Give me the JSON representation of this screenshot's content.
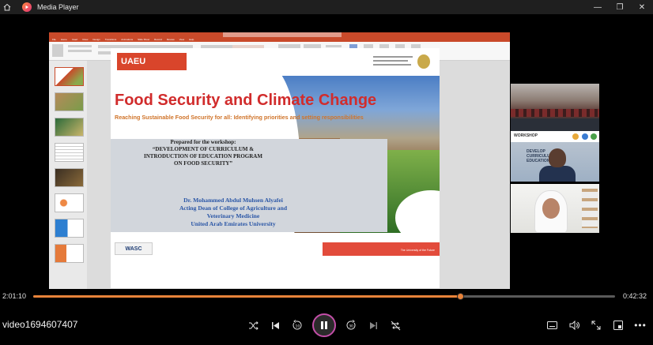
{
  "window": {
    "title": "Media Player",
    "controls": [
      "minimize-icon",
      "restore-icon",
      "close-icon"
    ]
  },
  "slide": {
    "logo_text": "UAEU",
    "title": "Food Security and Climate Change",
    "subtitle": "Reaching Sustainable Food Security for all: Identifying priorities and setting responsibilities",
    "prepared_lines": [
      "Prepared for the workshop:",
      "“DEVELOPMENT OF CURRICULUM &",
      "INTRODUCTION OF EDUCATION PROGRAM",
      "ON FOOD SECURITY”"
    ],
    "author_lines": [
      "Dr. Mohammed Abdul Muhsen Alyafei",
      "Acting Dean of College of Agriculture and",
      "Veterinary Medicine",
      "United Arab Emirates University"
    ],
    "footer_badge": "WASC",
    "footer_right": "The University of the Future"
  },
  "participants": {
    "banner_label": "WORKSHOP",
    "tile3_text_lines": [
      "DEVELOP",
      "CURRICULUM",
      "EDUCATION"
    ]
  },
  "player": {
    "elapsed": "2:01:10",
    "remaining": "0:42:32",
    "progress": 0.735,
    "filename": "video1694607407",
    "accent_color": "#e8833a",
    "playing": true
  }
}
